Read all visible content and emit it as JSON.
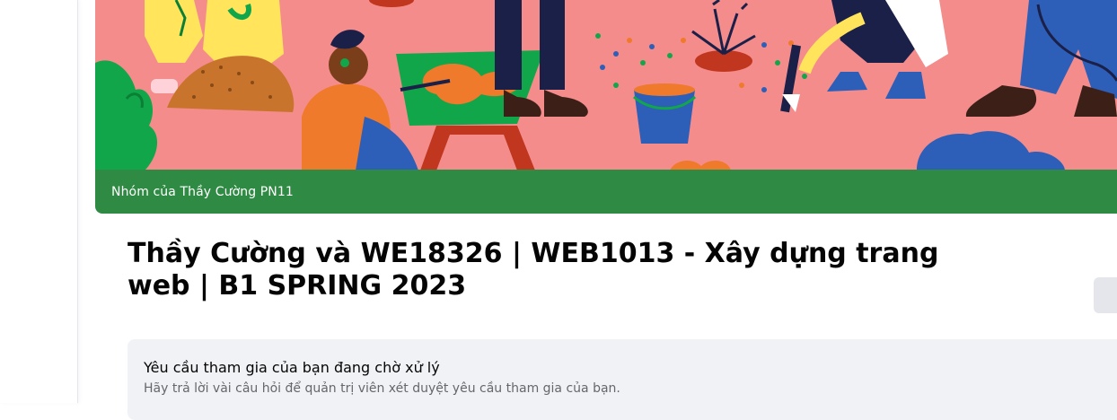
{
  "cover": {
    "group_bar_label": "Nhóm của Thầy Cường PN11"
  },
  "header": {
    "title": "Thầy Cường và WE18326 | WEB1013 - Xây dựng trang web | B1 SPRING 2023"
  },
  "pending": {
    "title": "Yêu cầu tham gia của bạn đang chờ xử lý",
    "subtitle": "Hãy trả lời vài câu hỏi để quản trị viên xét duyệt yêu cầu tham gia của bạn."
  },
  "colors": {
    "group_bar": "#2f8a43",
    "cover_bg": "#f48c8c",
    "card_bg": "#f0f2f5"
  }
}
